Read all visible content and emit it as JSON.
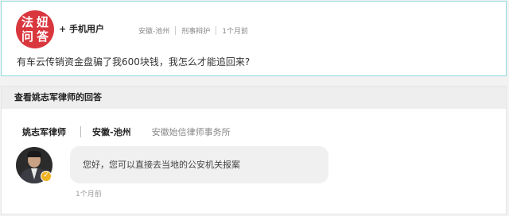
{
  "question": {
    "logo_chars": [
      "法",
      "妞",
      "问",
      "答"
    ],
    "user_name": "+ 手机用户",
    "location": "安徽-池州",
    "category": "刑事辩护",
    "time": "1个月前",
    "text": "有车云传销资金盘骗了我600块钱，我怎么才能追回来?"
  },
  "answer_section": {
    "header": "查看姚志军律师的回答",
    "lawyer_name": "姚志军律师",
    "lawyer_location": "安徽-池州",
    "lawyer_firm": "安徽始信律师事务所",
    "verify_icon": "✓",
    "answer_text": "您好，您可以直接去当地的公安机关报案",
    "answer_time": "1个月前"
  },
  "colors": {
    "logo_red": "#d9363e",
    "card_border": "#8fd8e0",
    "verify_gold": "#f0b323"
  }
}
